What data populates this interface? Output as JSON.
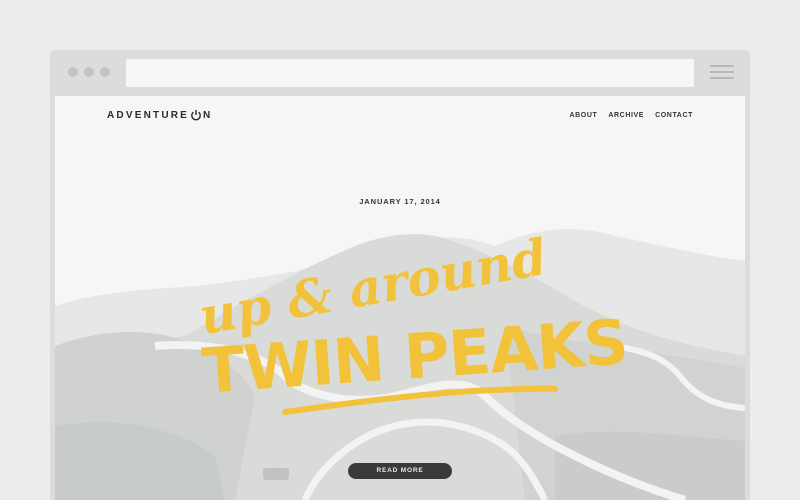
{
  "browser": {
    "dots": [
      "window-dot-1",
      "window-dot-2",
      "window-dot-3"
    ]
  },
  "site": {
    "logo_prefix": "ADVENTURE",
    "logo_suffix": "N",
    "logo_icon": "power-icon",
    "nav": [
      {
        "label": "ABOUT"
      },
      {
        "label": "ARCHIVE"
      },
      {
        "label": "CONTACT"
      }
    ]
  },
  "post": {
    "date": "JANUARY 17, 2014",
    "title_line1": "up & around",
    "title_line2": "TWIN PEAKS",
    "read_more": "READ MORE"
  },
  "colors": {
    "accent": "#f2c23a",
    "button": "#3a3a3a",
    "chrome": "#dcdcdc"
  }
}
